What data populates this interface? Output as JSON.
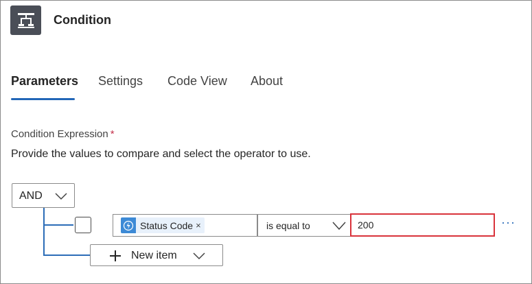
{
  "header": {
    "title": "Condition",
    "icon": "condition-icon",
    "icon_bg": "#4a4e57"
  },
  "tabs": [
    {
      "label": "Parameters",
      "active": true
    },
    {
      "label": "Settings",
      "active": false
    },
    {
      "label": "Code View",
      "active": false
    },
    {
      "label": "About",
      "active": false
    }
  ],
  "accent_color": "#2266b7",
  "condition": {
    "label": "Condition Expression",
    "required_mark": "*",
    "description": "Provide the values to compare and select the operator to use.",
    "group_operator": "AND",
    "rows": [
      {
        "checked": false,
        "left_token": {
          "label": "Status Code",
          "remove": "×",
          "icon": "http-trigger-icon"
        },
        "operator": "is equal to",
        "right_value": "200",
        "more": "···"
      }
    ],
    "new_item_label": "New item"
  }
}
